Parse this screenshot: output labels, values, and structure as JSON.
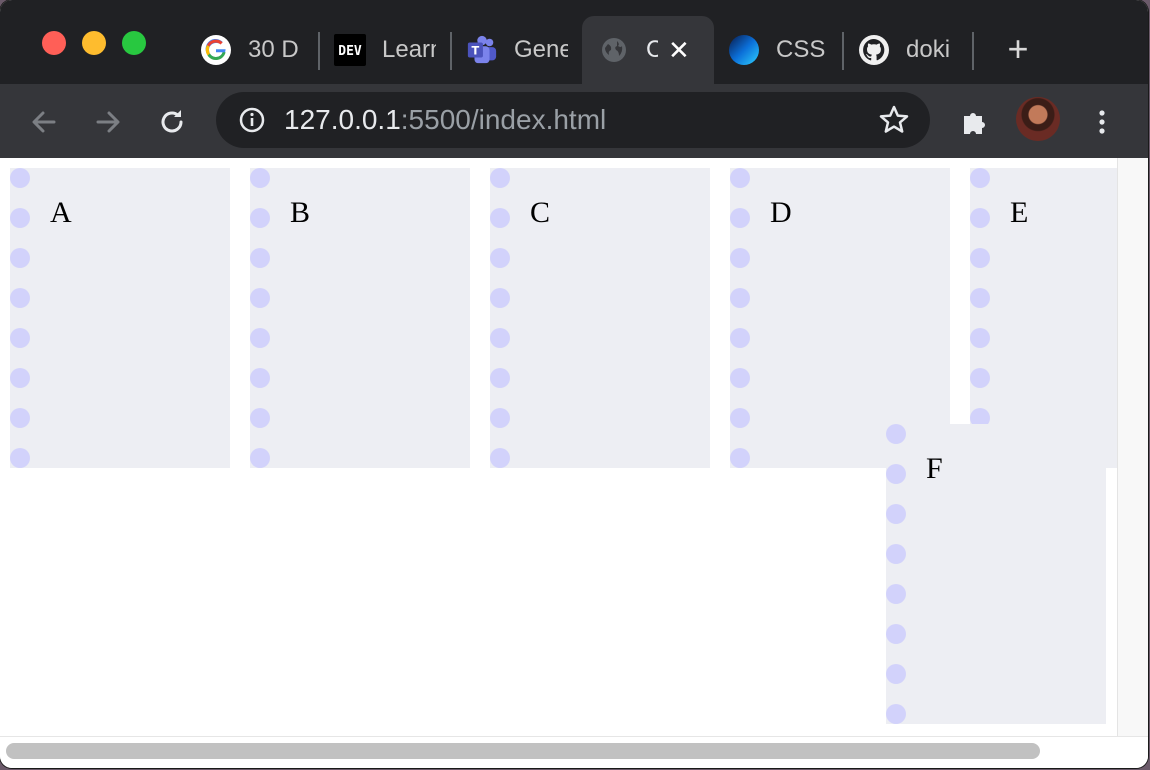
{
  "tabs": [
    {
      "title": "30 D",
      "icon": "google-icon"
    },
    {
      "title": "Learn",
      "icon": "dev-icon"
    },
    {
      "title": "Gene",
      "icon": "teams-icon"
    },
    {
      "title": "C",
      "icon": "globe-icon",
      "active": true
    },
    {
      "title": "CSS",
      "icon": "blue-sphere-icon"
    },
    {
      "title": "doki",
      "icon": "github-icon"
    }
  ],
  "new_tab_label": "+",
  "close_label": "✕",
  "toolbar": {
    "url_host": "127.0.0.1",
    "url_rest": ":5500/index.html"
  },
  "page": {
    "cards": [
      {
        "letter": "A"
      },
      {
        "letter": "B"
      },
      {
        "letter": "C"
      },
      {
        "letter": "D"
      },
      {
        "letter": "E"
      },
      {
        "letter": "F"
      }
    ]
  },
  "colors": {
    "card_bg": "#edeef3",
    "dot": "#d2d2fb",
    "tabstrip": "#202124",
    "toolbar": "#35363a"
  }
}
